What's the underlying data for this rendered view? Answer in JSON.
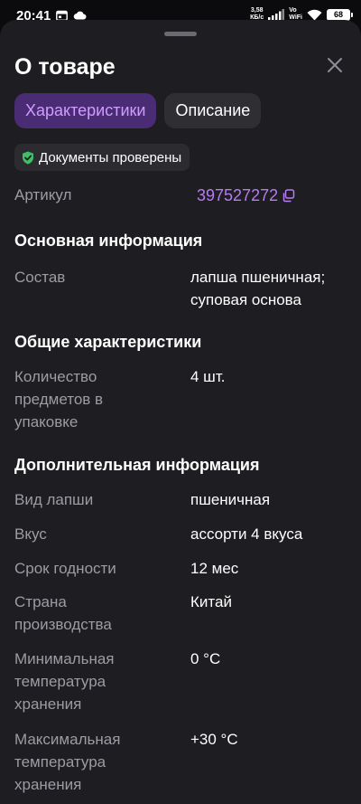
{
  "status_bar": {
    "time": "20:41",
    "speed_value": "3,58",
    "speed_unit": "КБ/с",
    "vo_label": "Vo",
    "wifi_label": "WiFi",
    "battery_level": "68"
  },
  "sheet": {
    "title": "О товаре",
    "tabs": [
      {
        "label": "Характеристики",
        "active": true
      },
      {
        "label": "Описание",
        "active": false
      }
    ],
    "badge": "Документы проверены",
    "article": {
      "label": "Артикул",
      "value": "397527272"
    },
    "sections": [
      {
        "title": "Основная информация",
        "rows": [
          {
            "label": "Состав",
            "value": "лапша пшеничная; суповая основа"
          }
        ]
      },
      {
        "title": "Общие характеристики",
        "rows": [
          {
            "label": "Количество предметов в упаковке",
            "value": "4 шт."
          }
        ]
      },
      {
        "title": "Дополнительная информация",
        "rows": [
          {
            "label": "Вид лапши",
            "value": "пшеничная"
          },
          {
            "label": "Вкус",
            "value": "ассорти 4 вкуса"
          },
          {
            "label": "Срок годности",
            "value": "12 мес"
          },
          {
            "label": "Страна производства",
            "value": "Китай"
          },
          {
            "label": "Минимальная температура хранения",
            "value": "0 °С"
          },
          {
            "label": "Максимальная температура хранения",
            "value": "+30 °С"
          }
        ]
      }
    ]
  },
  "colors": {
    "accent": "#b77bf2",
    "tab_active_bg": "#4a2c74",
    "sheet_bg": "#1e1d21",
    "badge_check": "#3fbf6a"
  }
}
